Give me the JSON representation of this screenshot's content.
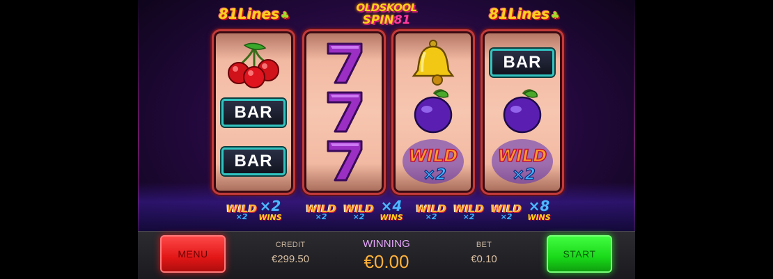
{
  "header": {
    "lines_left": "81Lines",
    "lines_right": "81Lines",
    "logo_line1": "OLDSKOOL",
    "logo_line2a": "SPIN",
    "logo_line2b": "81"
  },
  "reels": [
    [
      "cherry",
      "bar",
      "bar"
    ],
    [
      "seven",
      "seven",
      "seven"
    ],
    [
      "bell",
      "plum",
      "wild-x2"
    ],
    [
      "bar",
      "plum",
      "wild-x2"
    ]
  ],
  "symbols": {
    "bar_label": "BAR",
    "wild_label": "WILD",
    "wild_multiplier": "×2"
  },
  "wild_combos": [
    {
      "count": 1,
      "multiplier": "×2",
      "wins_label": "WINS"
    },
    {
      "count": 2,
      "multiplier": "×4",
      "wins_label": "WINS"
    },
    {
      "count": 3,
      "multiplier": "×8",
      "wins_label": "WINS"
    }
  ],
  "panel": {
    "menu_label": "MENU",
    "start_label": "START",
    "credit_label": "CREDIT",
    "credit_value": "€299.50",
    "winning_label": "WINNING",
    "winning_value": "€0.00",
    "bet_label": "BET",
    "bet_value": "€0.10"
  },
  "colors": {
    "menu_button": "#e21616",
    "start_button": "#19d719",
    "reel_frame": "#c33a3a",
    "winning_value": "#ffb13a"
  }
}
